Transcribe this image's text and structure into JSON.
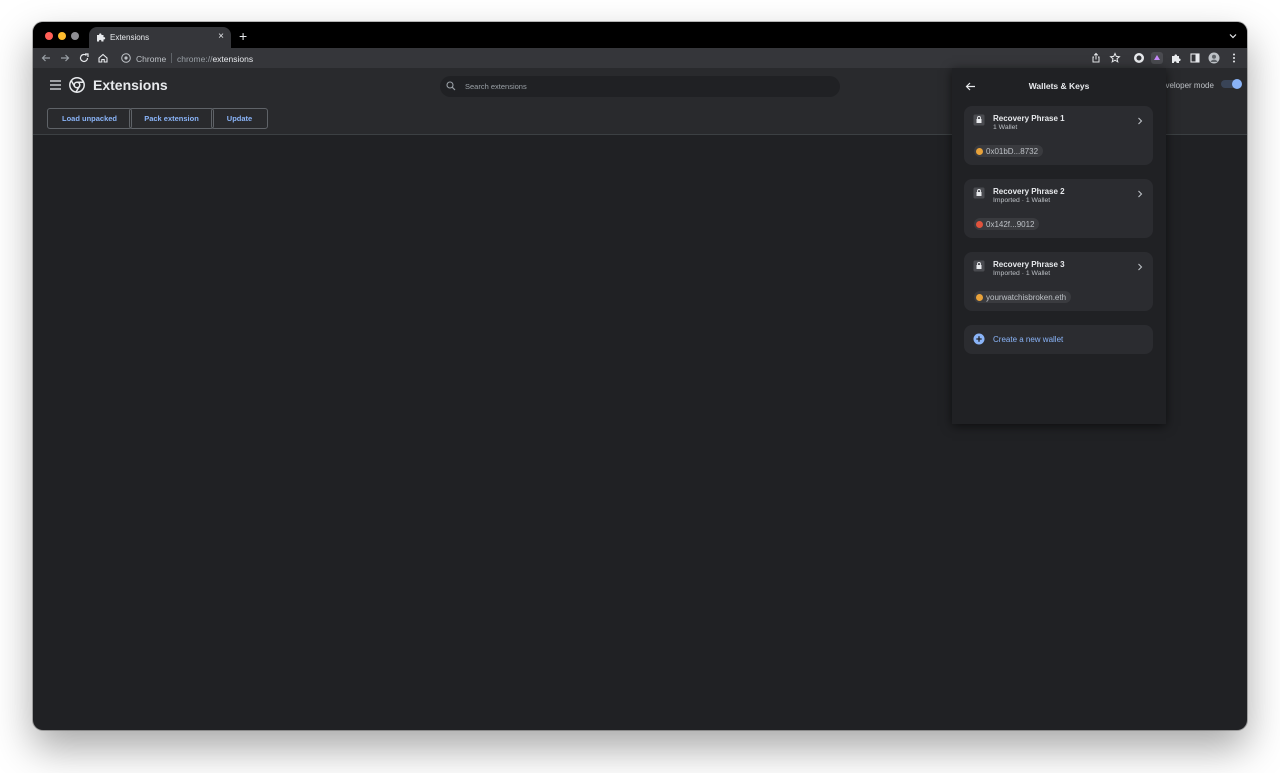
{
  "browser": {
    "tab": {
      "title": "Extensions",
      "close": "×"
    },
    "new_tab": "+",
    "omnibox": {
      "site_label": "Chrome",
      "url_scheme": "chrome://",
      "url_host": "extensions"
    }
  },
  "page": {
    "title": "Extensions",
    "search_placeholder": "Search extensions",
    "developer_mode_label": "eveloper mode",
    "developer_mode_on": true,
    "actions": [
      "Load unpacked",
      "Pack extension",
      "Update"
    ]
  },
  "popup": {
    "title": "Wallets & Keys",
    "phrases": [
      {
        "name": "Recovery Phrase 1",
        "subtitle": "1 Wallet",
        "address": "0x01bD...8732",
        "dot_color": "#e8a23a"
      },
      {
        "name": "Recovery Phrase 2",
        "subtitle": "Imported · 1 Wallet",
        "address": "0x142f...9012",
        "dot_color": "#e0533d"
      },
      {
        "name": "Recovery Phrase 3",
        "subtitle": "Imported · 1 Wallet",
        "address": "yourwatchisbroken.eth",
        "dot_color": "#e8a23a"
      }
    ],
    "create_label": "Create a new wallet"
  },
  "colors": {
    "accent": "#8ab4f8",
    "background": "#202124",
    "card": "#2b2c30"
  }
}
